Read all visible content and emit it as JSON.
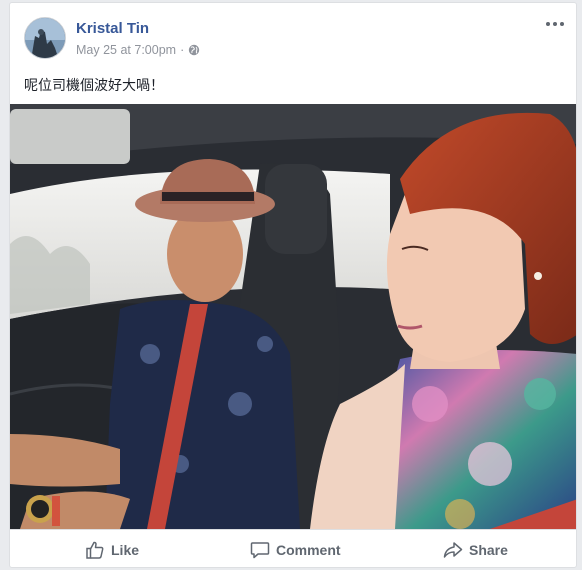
{
  "post": {
    "author": "Kristal Tin",
    "date": "May 25 at 7:00pm",
    "separator": "·",
    "audience_icon": "globe-icon",
    "text": "呢位司機個波好大喎！",
    "more_icon": "more-horizontal-icon"
  },
  "photo": {
    "alt": "Selfie of a woman in a car beside a man in a hat driving"
  },
  "actions": {
    "like_label": "Like",
    "comment_label": "Comment",
    "share_label": "Share"
  },
  "colors": {
    "author_link": "#385898",
    "meta_text": "#90949c",
    "action_text": "#606770",
    "card_border": "#dddfe2",
    "page_bg": "#e9ebee"
  }
}
